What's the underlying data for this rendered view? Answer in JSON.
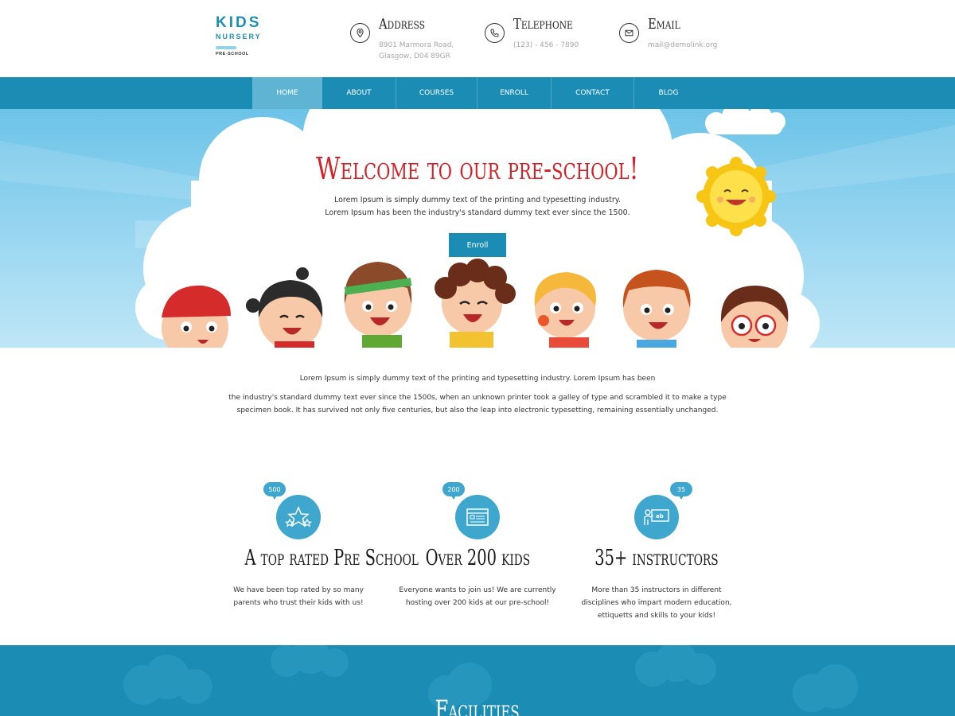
{
  "logo": {
    "line1": "KIDS",
    "line2": "NURSERY",
    "line3": "PRE-SCHOOL"
  },
  "contacts": [
    {
      "title": "Address",
      "icon": "map-pin-icon",
      "lines": [
        "8901 Marmora Road,",
        "Glasgow, D04 89GR"
      ]
    },
    {
      "title": "Telephone",
      "icon": "phone-icon",
      "lines": [
        "(123) - 456 - 7890"
      ]
    },
    {
      "title": "Email",
      "icon": "mail-icon",
      "lines": [
        "mail@demolink.org"
      ]
    }
  ],
  "nav": {
    "items": [
      "HOME",
      "ABOUT",
      "COURSES",
      "ENROLL",
      "CONTACT",
      "BLOG"
    ],
    "active": "HOME"
  },
  "hero": {
    "title": "Welcome to our pre-school!",
    "line1": "Lorem Ipsum is simply dummy text of the printing and typesetting industry.",
    "line2": "Lorem Ipsum has been the industry's standard dummy text ever since the 1500.",
    "button": "Enroll"
  },
  "intro": {
    "p1": "Lorem Ipsum is simply dummy text of the printing and typesetting industry. Lorem Ipsum has been",
    "p2a": "the industry's standard dummy text ever since the 1500s, when an unknown printer took a galley of type and scrambled it to make a type",
    "p2b": "specimen book. It has survived not only five centuries, but also the leap into electronic typesetting, remaining essentially unchanged."
  },
  "features": [
    {
      "badge": "500",
      "icon": "stars-icon",
      "title": "A top rated Pre School",
      "text": "We have been top rated by so many parents who trust their kids with us!"
    },
    {
      "badge": "200",
      "icon": "board-icon",
      "title": "Over 200 kids",
      "text": "Everyone wants to join us! We are currently hosting over 200 kids at our pre-school!"
    },
    {
      "badge": "35",
      "icon": "teacher-icon",
      "title": "35+ instructors",
      "text": "More than 35 instructors in different disciplines who impart modern education, ettiquetts and skills to your kids!"
    }
  ],
  "band": {
    "title": "Facilities"
  },
  "colors": {
    "primary": "#1b8db5",
    "accent_red": "#d42026",
    "badge": "#3fa7cd"
  }
}
